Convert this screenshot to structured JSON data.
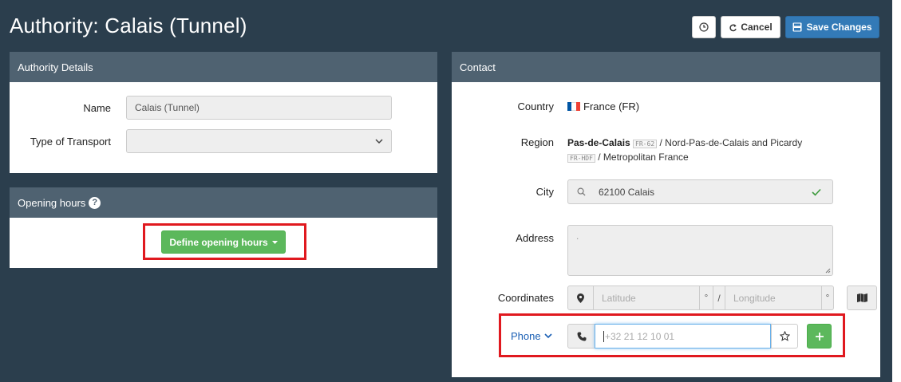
{
  "header": {
    "title": "Authority: Calais (Tunnel)",
    "history_icon": "clock-icon",
    "cancel_icon": "undo-icon",
    "cancel_label": "Cancel",
    "save_icon": "floppy-disk-icon",
    "save_label": "Save Changes"
  },
  "authority_details": {
    "heading": "Authority Details",
    "name_label": "Name",
    "name_value": "Calais (Tunnel)",
    "transport_label": "Type of Transport",
    "transport_value": ""
  },
  "opening_hours": {
    "heading": "Opening hours",
    "help_glyph": "?",
    "define_button_label": "Define opening hours"
  },
  "contact": {
    "heading": "Contact",
    "country_label": "Country",
    "country_value": "France (FR)",
    "country_flag_colors": [
      "#0055a4",
      "#ffffff",
      "#ef4135"
    ],
    "region_label": "Region",
    "region_name": "Pas-de-Calais",
    "region_code": "FR-62",
    "region_parent": "/ Nord-Pas-de-Calais and Picardy",
    "region_parent_code": "FR-HDF",
    "region_root": "/ Metropolitan France",
    "city_label": "City",
    "city_value": "62100 Calais",
    "address_label": "Address",
    "address_value": ".",
    "coordinates_label": "Coordinates",
    "latitude_placeholder": "Latitude",
    "longitude_placeholder": "Longitude",
    "degree_symbol": "°",
    "separator": "/",
    "phone_label": "Phone",
    "phone_placeholder": "+32 21 12 10 01"
  },
  "colors": {
    "background": "#2b3e4d",
    "panel_heading": "#4f6271",
    "primary": "#337ab7",
    "success": "#5cb85c",
    "highlight": "#e0191f",
    "link": "#1a5fb4"
  }
}
